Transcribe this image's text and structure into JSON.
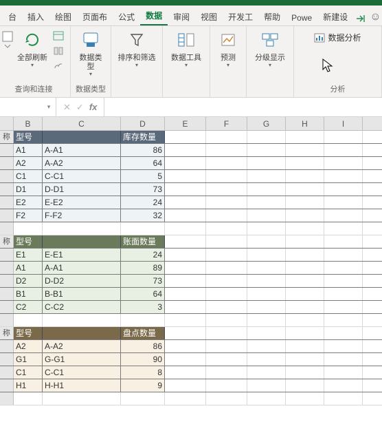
{
  "tabs": {
    "t0": "台",
    "t1": "插入",
    "t2": "绘图",
    "t3": "页面布",
    "t4": "公式",
    "t5": "数据",
    "t6": "审阅",
    "t7": "视图",
    "t8": "开发工",
    "t9": "帮助",
    "t10": "Powe",
    "t11": "新建设"
  },
  "ribbon": {
    "group1_label": "查询和连接",
    "refresh_all": "全部刷新",
    "group2_label": "数据类型",
    "data_types": "数据类\n型",
    "group3_label": "",
    "sort_filter": "排序和筛选",
    "data_tools": "数据工具",
    "forecast": "预测",
    "outline": "分级显示",
    "analysis_label": "分析",
    "data_analysis": "数据分析"
  },
  "fx": {
    "cancel": "✕",
    "enter": "✓",
    "fx": "fx"
  },
  "cols": {
    "A": "",
    "B": "B",
    "C": "C",
    "D": "D",
    "E": "E",
    "F": "F",
    "G": "G",
    "H": "H",
    "I": "I"
  },
  "section1": {
    "h_a": "称",
    "h_b": "型号",
    "h_d": "库存数量",
    "rows": [
      {
        "b": "A1",
        "c": "A-A1",
        "d": "86"
      },
      {
        "b": "A2",
        "c": "A-A2",
        "d": "64"
      },
      {
        "b": "C1",
        "c": "C-C1",
        "d": "5"
      },
      {
        "b": "D1",
        "c": "D-D1",
        "d": "73"
      },
      {
        "b": "E2",
        "c": "E-E2",
        "d": "24"
      },
      {
        "b": "F2",
        "c": "F-F2",
        "d": "32"
      }
    ]
  },
  "section2": {
    "h_a": "称",
    "h_b": "型号",
    "h_d": "账面数量",
    "rows": [
      {
        "b": "E1",
        "c": "E-E1",
        "d": "24"
      },
      {
        "b": "A1",
        "c": "A-A1",
        "d": "89"
      },
      {
        "b": "D2",
        "c": "D-D2",
        "d": "73"
      },
      {
        "b": "B1",
        "c": "B-B1",
        "d": "64"
      },
      {
        "b": "C2",
        "c": "C-C2",
        "d": "3"
      }
    ]
  },
  "section3": {
    "h_a": "称",
    "h_b": "型号",
    "h_d": "盘点数量",
    "rows": [
      {
        "b": "A2",
        "c": "A-A2",
        "d": "86"
      },
      {
        "b": "G1",
        "c": "G-G1",
        "d": "90"
      },
      {
        "b": "C1",
        "c": "C-C1",
        "d": "8"
      },
      {
        "b": "H1",
        "c": "H-H1",
        "d": "9"
      }
    ]
  }
}
